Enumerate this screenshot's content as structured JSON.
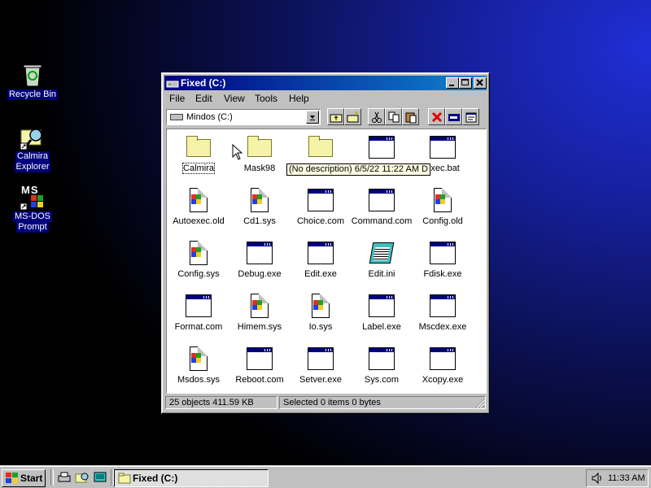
{
  "desktop": {
    "icons": [
      {
        "label": "Recycle Bin",
        "icon": "recycle-bin-icon"
      },
      {
        "label": "Calmira",
        "label2": "Explorer",
        "icon": "calmira-explorer-icon"
      },
      {
        "label": "MS-DOS",
        "label2": "Prompt",
        "icon": "ms-dos-icon",
        "glyph": "MS"
      }
    ]
  },
  "window": {
    "title": "Fixed (C:)",
    "menu": [
      "File",
      "Edit",
      "View",
      "Tools",
      "Help"
    ],
    "address": "Mindos (C:)",
    "tooltip": "(No description)  6/5/22  11:22 AM  D",
    "files": [
      {
        "name": "Calmira",
        "type": "folder"
      },
      {
        "name": "Mask98",
        "type": "folder"
      },
      {
        "name": "",
        "type": "folder"
      },
      {
        "name": "",
        "type": "app"
      },
      {
        "name": "exec.bat",
        "type": "app"
      },
      {
        "name": "Autoexec.old",
        "type": "sys"
      },
      {
        "name": "Cd1.sys",
        "type": "sys"
      },
      {
        "name": "Choice.com",
        "type": "app"
      },
      {
        "name": "Command.com",
        "type": "app"
      },
      {
        "name": "Config.old",
        "type": "sys"
      },
      {
        "name": "Config.sys",
        "type": "sys"
      },
      {
        "name": "Debug.exe",
        "type": "app"
      },
      {
        "name": "Edit.exe",
        "type": "app"
      },
      {
        "name": "Edit.ini",
        "type": "ini"
      },
      {
        "name": "Fdisk.exe",
        "type": "app"
      },
      {
        "name": "Format.com",
        "type": "app"
      },
      {
        "name": "Himem.sys",
        "type": "sys"
      },
      {
        "name": "Io.sys",
        "type": "sys"
      },
      {
        "name": "Label.exe",
        "type": "app"
      },
      {
        "name": "Mscdex.exe",
        "type": "app"
      },
      {
        "name": "Msdos.sys",
        "type": "sys"
      },
      {
        "name": "Reboot.com",
        "type": "app"
      },
      {
        "name": "Setver.exe",
        "type": "app"
      },
      {
        "name": "Sys.com",
        "type": "app"
      },
      {
        "name": "Xcopy.exe",
        "type": "app"
      }
    ],
    "status": {
      "objects": "25 objects  411.59 KB",
      "selected": "Selected 0 items  0 bytes"
    }
  },
  "taskbar": {
    "start": "Start",
    "task": "Fixed (C:)",
    "clock": "11:33 AM"
  },
  "colors": {
    "title_start": "#000080",
    "title_end": "#1084d0",
    "face": "#c0c0c0"
  }
}
